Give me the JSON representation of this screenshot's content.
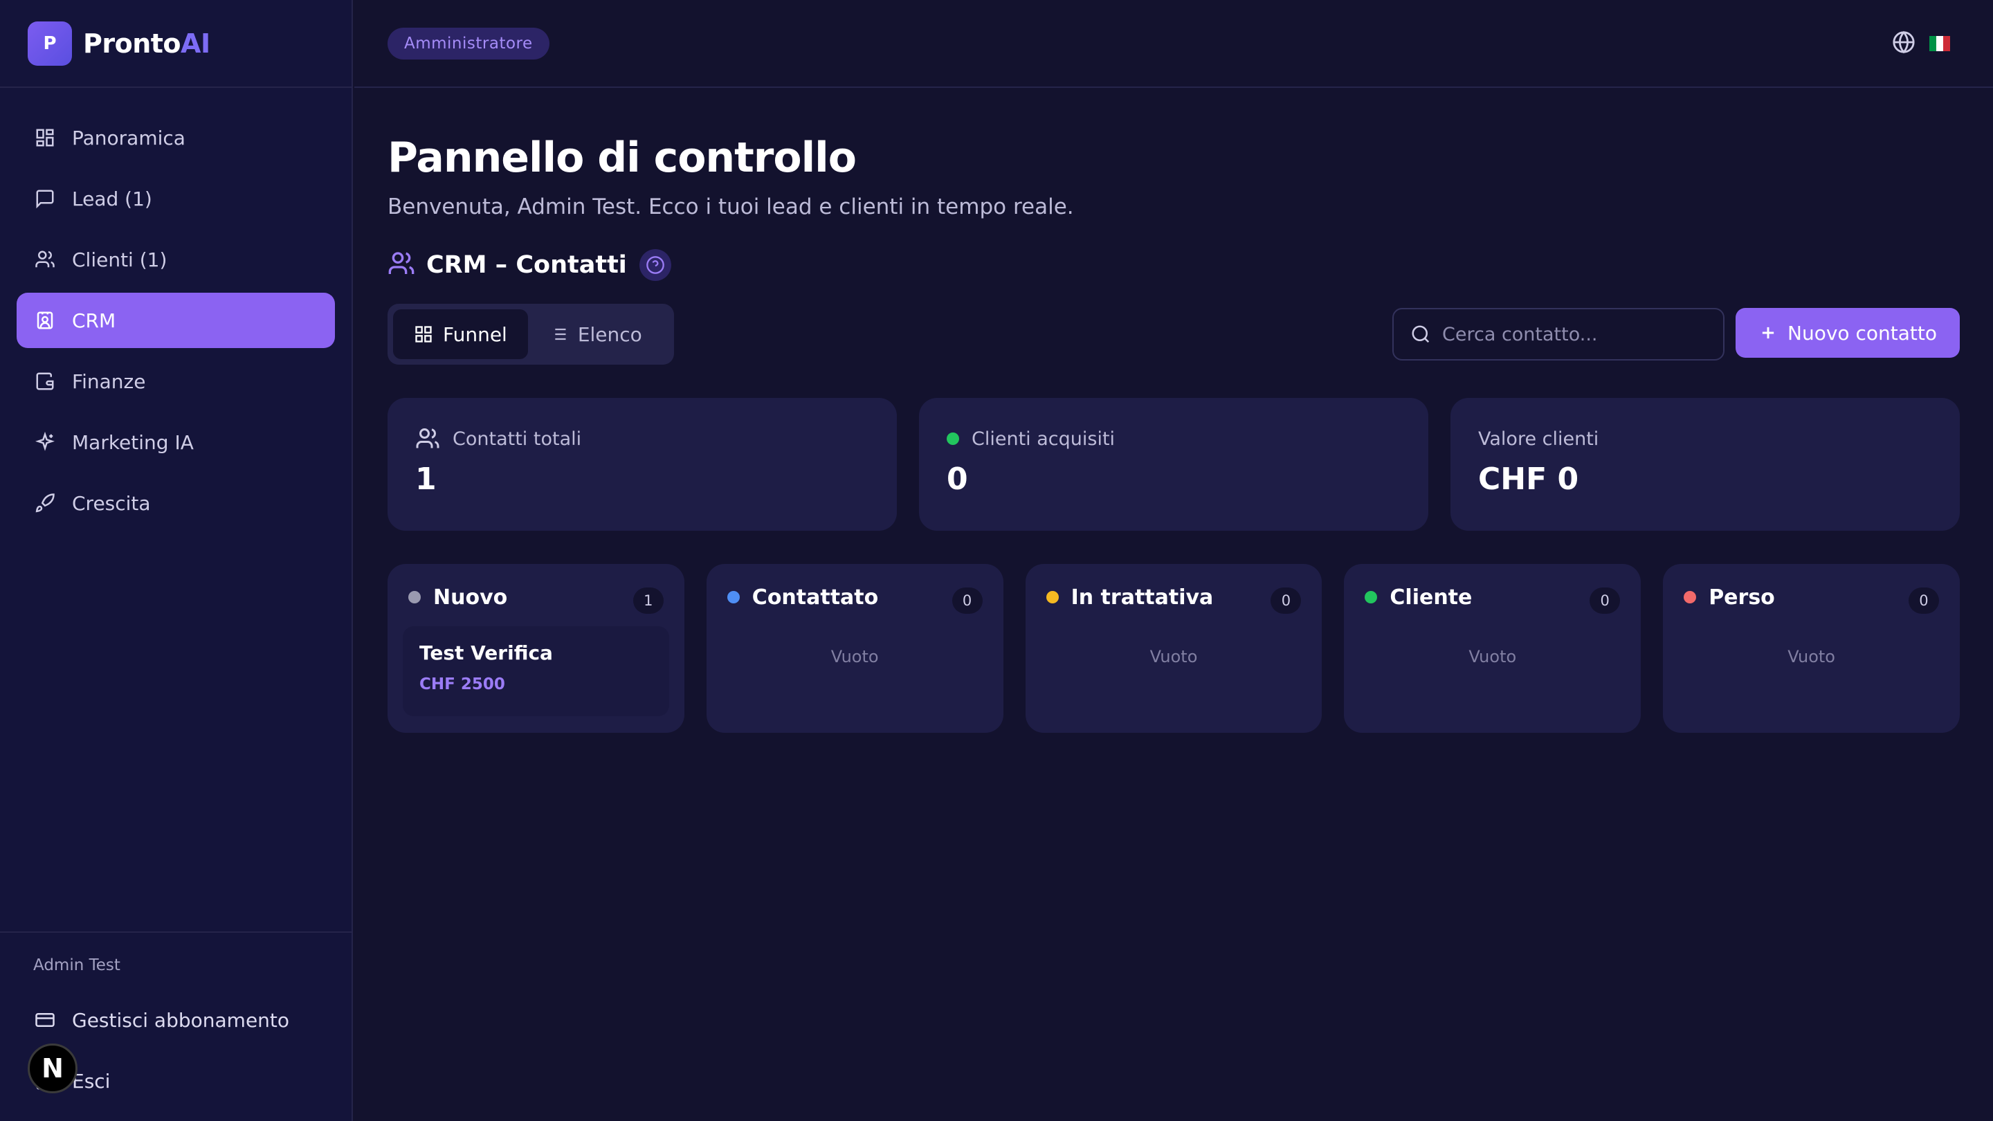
{
  "brand": {
    "logo_letter": "P",
    "name_main": "Pronto",
    "name_ai": "AI"
  },
  "sidebar": {
    "items": [
      {
        "label": "Panoramica",
        "icon": "grid-icon"
      },
      {
        "label": "Lead (1)",
        "icon": "chat-icon"
      },
      {
        "label": "Clienti (1)",
        "icon": "users-icon"
      },
      {
        "label": "CRM",
        "icon": "contact-card-icon",
        "active": true
      },
      {
        "label": "Finanze",
        "icon": "wallet-icon"
      },
      {
        "label": "Marketing IA",
        "icon": "sparkles-icon"
      },
      {
        "label": "Crescita",
        "icon": "rocket-icon"
      }
    ],
    "footer": {
      "user": "Admin Test",
      "manage_subscription": "Gestisci abbonamento",
      "logout": "Esci"
    },
    "nextjs_badge": "N"
  },
  "topbar": {
    "role_badge": "Amministratore"
  },
  "page": {
    "title": "Pannello di controllo",
    "subtitle": "Benvenuta, Admin Test. Ecco i tuoi lead e clienti in tempo reale."
  },
  "crm": {
    "section_title": "CRM – Contatti",
    "views": {
      "funnel": "Funnel",
      "list": "Elenco"
    },
    "search_placeholder": "Cerca contatto...",
    "new_contact": "Nuovo contatto",
    "stats": {
      "total_label": "Contatti totali",
      "total_value": "1",
      "acquired_label": "Clienti acquisiti",
      "acquired_value": "0",
      "value_label": "Valore clienti",
      "value_value": "CHF 0"
    },
    "empty_label": "Vuoto",
    "stages": [
      {
        "name": "Nuovo",
        "count": "1",
        "color": "#9a9ab0"
      },
      {
        "name": "Contattato",
        "count": "0",
        "color": "#4f8ff5"
      },
      {
        "name": "In trattativa",
        "count": "0",
        "color": "#f5b922"
      },
      {
        "name": "Cliente",
        "count": "0",
        "color": "#22c55e"
      },
      {
        "name": "Perso",
        "count": "0",
        "color": "#f26a6a"
      }
    ],
    "deal": {
      "name": "Test Verifica",
      "value": "CHF 2500"
    }
  },
  "colors": {
    "accent": "#8b63f2",
    "success": "#22c55e",
    "flag_green": "#009246",
    "flag_white": "#ffffff",
    "flag_red": "#ce2b37"
  }
}
